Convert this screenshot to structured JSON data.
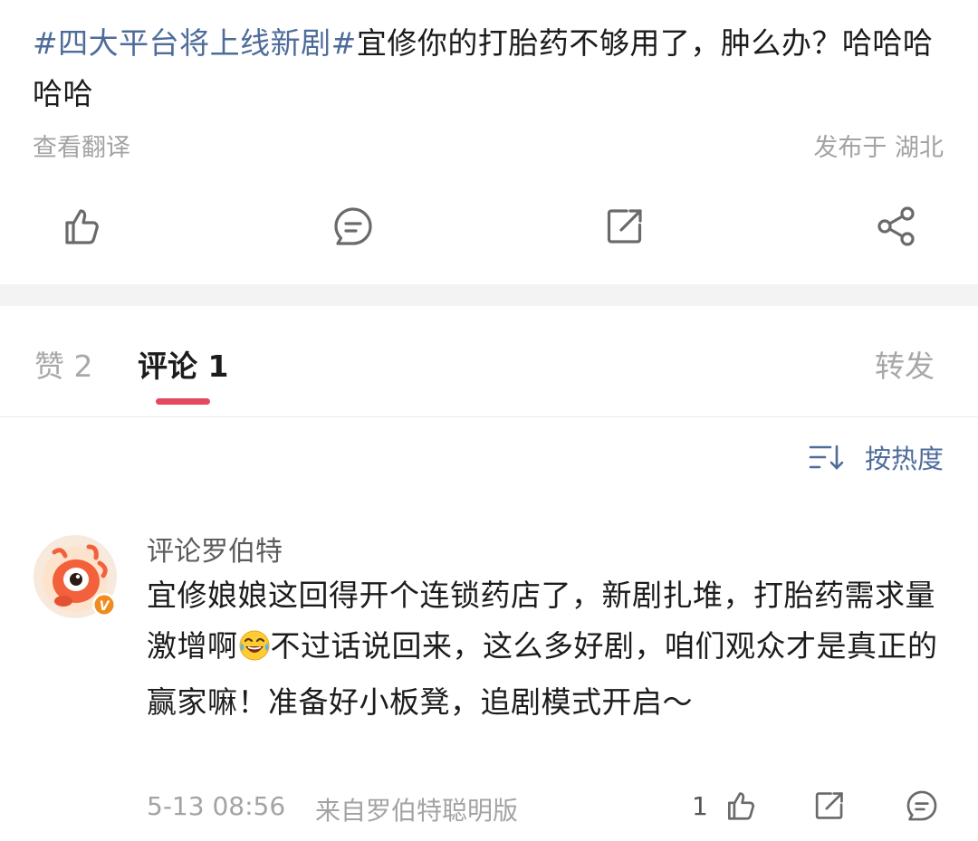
{
  "post": {
    "topic": "#四大平台将上线新剧#",
    "text": "宜修你的打胎药不够用了，肿么办？哈哈哈哈哈",
    "translate_label": "查看翻译",
    "location": "发布于 湖北"
  },
  "action_bar": {
    "icons": [
      "like-icon",
      "comment-icon",
      "repost-icon",
      "share-icon"
    ]
  },
  "tabs": {
    "likes": "赞 2",
    "comments": "评论 1",
    "reposts": "转发"
  },
  "sort": {
    "icon": "sort-icon",
    "label": "按热度"
  },
  "comment": {
    "author": "评论罗伯特",
    "text_before_emoji": "宜修娘娘这回得开个连锁药店了，新剧扎堆，打胎药需求量激增啊",
    "emoji": "laughing-tears-emoji",
    "text_after_emoji": "不过话说回来，这么多好剧，咱们观众才是真正的赢家嘛！准备好小板凳，追剧模式开启～",
    "time": "5-13 08:56",
    "source": "来自罗伯特聪明版",
    "like_count": "1",
    "verified_badge": "V"
  },
  "colors": {
    "link": "#4e6c9a",
    "tab_indicator": "#e5485f",
    "badge": "#f08c1e",
    "avatar_mascot": "#f2613c"
  }
}
